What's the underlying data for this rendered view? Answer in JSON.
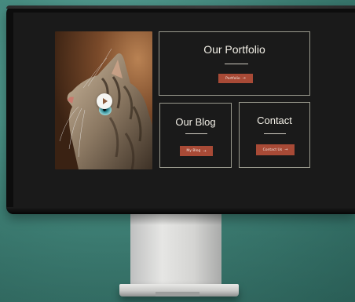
{
  "portfolio": {
    "title": "Our Portfolio",
    "button_label": "Portfolio",
    "arrow": "→"
  },
  "blog": {
    "title": "Our Blog",
    "button_label": "My Blog",
    "arrow": "→"
  },
  "contact": {
    "title": "Contact",
    "button_label": "Contact Us",
    "arrow": "→"
  },
  "colors": {
    "accent": "#a84a36",
    "screen_bg": "#1a1a1a",
    "card_border": "#9a9a8e",
    "wall": "#4a8f85"
  },
  "icons": {
    "photo_play": "play-icon"
  }
}
